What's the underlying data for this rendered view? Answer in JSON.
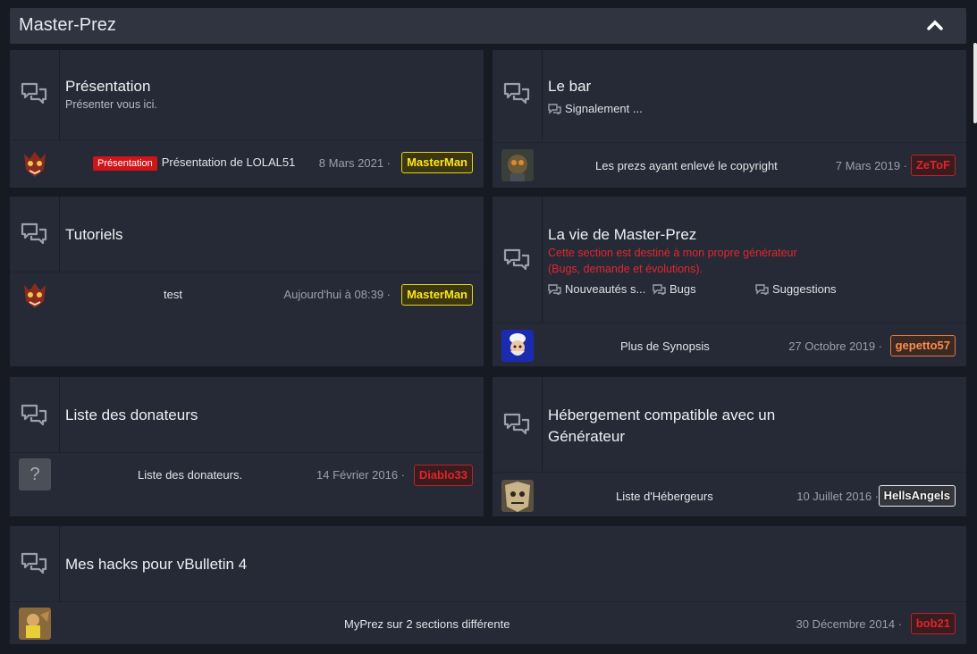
{
  "category": {
    "title": "Master-Prez"
  },
  "colors": {
    "bg": "#171a22",
    "panel": "#252a36",
    "header": "#2f3440",
    "prefix": "#d01418"
  },
  "icons": {
    "forum": "forum-bubbles-icon",
    "sub": "subforum-bubble-icon",
    "collapse": "chevron-up-icon"
  },
  "nodes": {
    "presentation": {
      "title": "Présentation",
      "desc": "Présenter vous ici.",
      "prefix": "Présentation",
      "last_post": "Présentation de LOLAL51",
      "date": "8 Mars 2021 ·",
      "user": "MasterMan"
    },
    "bar": {
      "title": "Le bar",
      "sub1": "Signalement ...",
      "last_post": "Les prezs ayant enlevé le copyright",
      "date": "7 Mars 2019 ·",
      "user": "ZeToF"
    },
    "tutoriels": {
      "title": "Tutoriels",
      "last_post": "test",
      "date": "Aujourd'hui à 08:39 ·",
      "user": "MasterMan"
    },
    "vie": {
      "title": "La vie de Master-Prez",
      "desc_line1": "Cette section est destiné à mon propre générateur",
      "desc_line2": "(Bugs, demande et évolutions).",
      "sub1": "Nouveautés s...",
      "sub2": "Bugs",
      "sub3": "Suggestions",
      "last_post": "Plus de Synopsis",
      "date": "27 Octobre 2019 ·",
      "user": "gepetto57"
    },
    "donateurs": {
      "title": "Liste des donateurs",
      "avatar_text": "?",
      "last_post": "Liste des donateurs.",
      "date": "14 Février 2016 ·",
      "user": "Diablo33"
    },
    "hebergement": {
      "title_line1": "Hébergement compatible avec un",
      "title_line2": "Générateur",
      "last_post": "Liste d'Hébergeurs",
      "date": "10 Juillet 2016 ·",
      "user": "HellsAngels"
    },
    "hacks": {
      "title": "Mes hacks pour vBulletin 4",
      "last_post": "MyPrez sur 2 sections différente",
      "date": "30 Décembre 2014 ·",
      "user": "bob21"
    }
  }
}
